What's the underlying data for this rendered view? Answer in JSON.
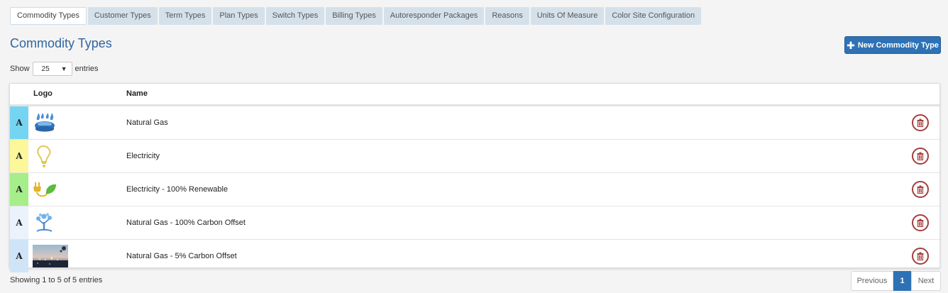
{
  "tabs": [
    {
      "label": "Commodity Types",
      "active": true
    },
    {
      "label": "Customer Types"
    },
    {
      "label": "Term Types"
    },
    {
      "label": "Plan Types"
    },
    {
      "label": "Switch Types"
    },
    {
      "label": "Billing Types"
    },
    {
      "label": "Autoresponder Packages"
    },
    {
      "label": "Reasons"
    },
    {
      "label": "Units Of Measure"
    },
    {
      "label": "Color Site Configuration"
    }
  ],
  "page_title": "Commodity Types",
  "new_button": {
    "label": "New Commodity Type",
    "icon": "plus-icon"
  },
  "length_control": {
    "show": "Show",
    "value": "25",
    "entries": "entries"
  },
  "table": {
    "headers": {
      "logo": "Logo",
      "name": "Name"
    },
    "rows": [
      {
        "mark": "A",
        "color": "#75d4f2",
        "logo_icon": "gas-flame-icon",
        "name": "Natural Gas"
      },
      {
        "mark": "A",
        "color": "#fbf79a",
        "logo_icon": "light-bulb-icon",
        "name": "Electricity"
      },
      {
        "mark": "A",
        "color": "#a5ee8a",
        "logo_icon": "plug-leaf-icon",
        "name": "Electricity - 100% Renewable"
      },
      {
        "mark": "A",
        "color": "#eaf2fb",
        "logo_icon": "tree-icon",
        "name": "Natural Gas - 100% Carbon Offset"
      },
      {
        "mark": "A",
        "color": "#cfe4f7",
        "logo_icon": "photo-thumbnail-icon",
        "name": "Natural Gas - 5% Carbon Offset"
      }
    ]
  },
  "info": "Showing 1 to 5 of 5 entries",
  "pagination": {
    "previous": "Previous",
    "current": "1",
    "next": "Next"
  },
  "colors": {
    "accent": "#2e72b5",
    "title": "#31659e",
    "delete": "#a43d3d"
  }
}
